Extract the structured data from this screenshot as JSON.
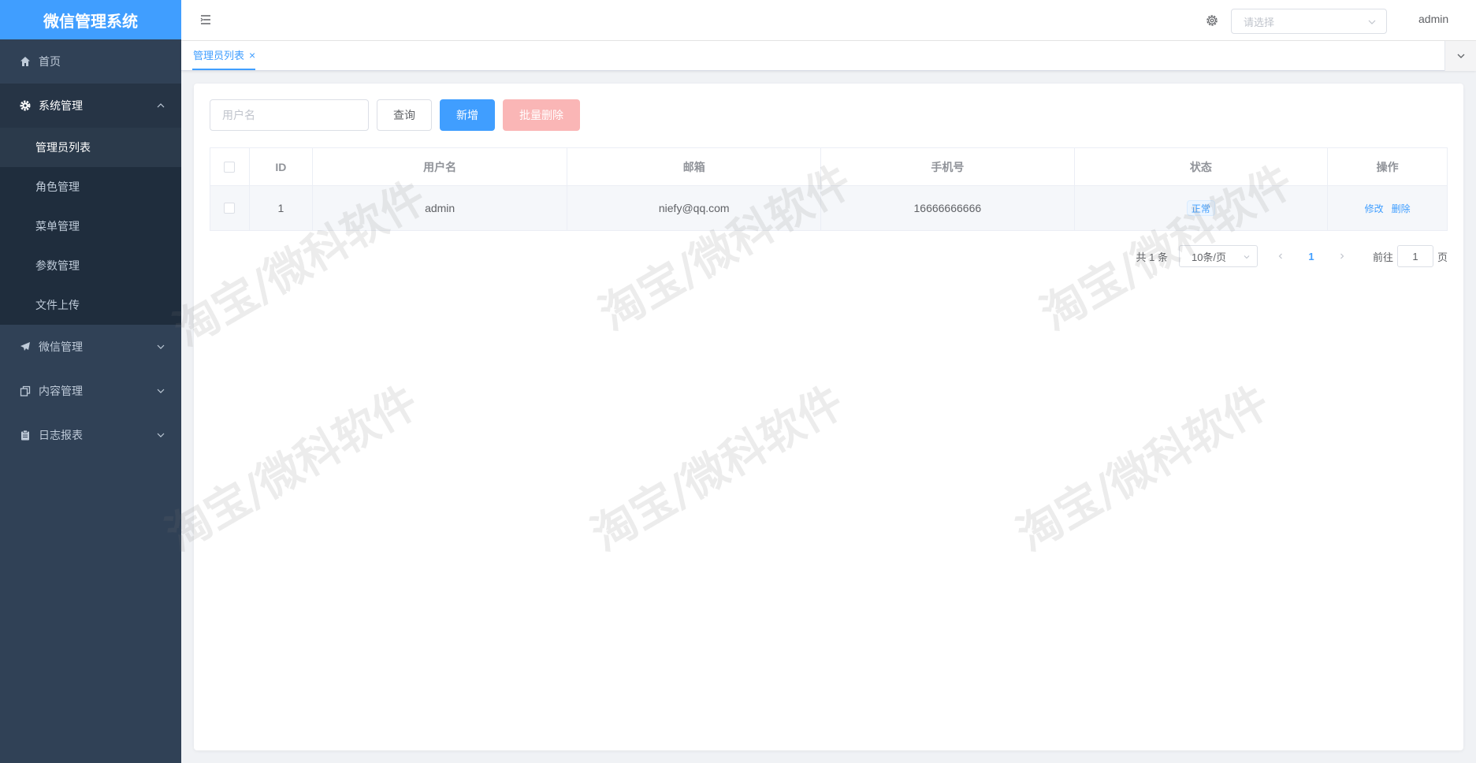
{
  "app": {
    "title": "微信管理系统"
  },
  "sidebar": {
    "items": [
      {
        "label": "首页",
        "icon": "home-icon"
      },
      {
        "label": "系统管理",
        "icon": "gear-icon",
        "expanded": true,
        "children": [
          {
            "label": "管理员列表",
            "active": true
          },
          {
            "label": "角色管理"
          },
          {
            "label": "菜单管理"
          },
          {
            "label": "参数管理"
          },
          {
            "label": "文件上传"
          }
        ]
      },
      {
        "label": "微信管理",
        "icon": "paper-plane-icon"
      },
      {
        "label": "内容管理",
        "icon": "copy-icon"
      },
      {
        "label": "日志报表",
        "icon": "clipboard-icon"
      }
    ]
  },
  "header": {
    "select_placeholder": "请选择",
    "user": "admin"
  },
  "tabs": [
    {
      "label": "管理员列表",
      "close": "×"
    }
  ],
  "toolbar": {
    "search_placeholder": "用户名",
    "query_label": "查询",
    "add_label": "新增",
    "batch_delete_label": "批量删除"
  },
  "table": {
    "columns": [
      "ID",
      "用户名",
      "邮箱",
      "手机号",
      "状态",
      "操作"
    ],
    "rows": [
      {
        "id": "1",
        "username": "admin",
        "email": "niefy@qq.com",
        "phone": "16666666666",
        "status": "正常",
        "actions": [
          "修改",
          "删除"
        ]
      }
    ]
  },
  "pagination": {
    "total": "共 1 条",
    "page_size": "10条/页",
    "current": "1",
    "goto_prefix": "前往",
    "goto_value": "1",
    "goto_suffix": "页"
  },
  "watermark": "淘宝/微科软件",
  "colors": {
    "primary": "#409EFF",
    "sidebar": "#304156",
    "danger_disabled": "#fab6b6"
  }
}
